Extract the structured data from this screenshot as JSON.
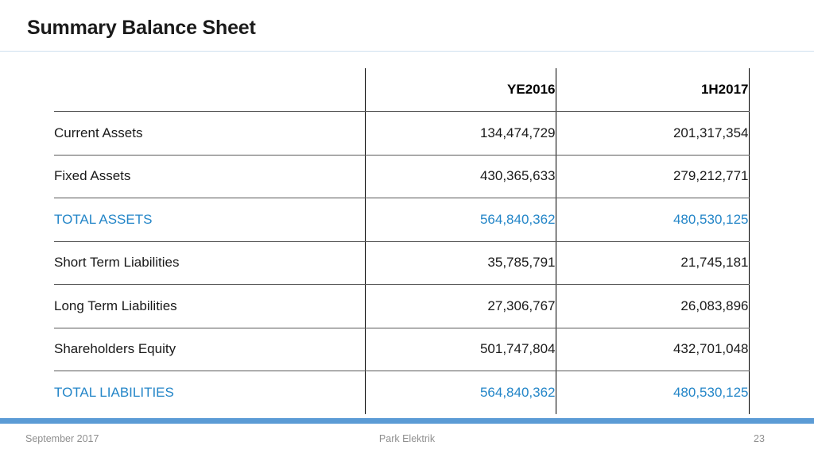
{
  "slide": {
    "title": "Summary Balance Sheet",
    "accent_blue": "#5b9bd5",
    "total_blue": "#2486c8",
    "rule_color": "#cfe0ef"
  },
  "table": {
    "columns": [
      {
        "key": "label",
        "header": ""
      },
      {
        "key": "ye2016",
        "header": "YE2016"
      },
      {
        "key": "h1_2017",
        "header": "1H2017"
      }
    ],
    "rows": [
      {
        "label": "Current Assets",
        "ye2016": "134,474,729",
        "h1_2017": "201,317,354",
        "emphasis": "normal"
      },
      {
        "label": "Fixed Assets",
        "ye2016": "430,365,633",
        "h1_2017": "279,212,771",
        "emphasis": "normal"
      },
      {
        "label": "TOTAL ASSETS",
        "ye2016": "564,840,362",
        "h1_2017": "480,530,125",
        "emphasis": "total"
      },
      {
        "label": "Short Term Liabilities",
        "ye2016": "35,785,791",
        "h1_2017": "21,745,181",
        "emphasis": "normal"
      },
      {
        "label": "Long Term Liabilities",
        "ye2016": "27,306,767",
        "h1_2017": "26,083,896",
        "emphasis": "normal"
      },
      {
        "label": "Shareholders Equity",
        "ye2016": "501,747,804",
        "h1_2017": "432,701,048",
        "emphasis": "normal"
      },
      {
        "label": "TOTAL LIABILITIES",
        "ye2016": "564,840,362",
        "h1_2017": "480,530,125",
        "emphasis": "total"
      }
    ]
  },
  "footer": {
    "date": "September 2017",
    "company": "Park Elektrik",
    "page_number": "23"
  }
}
